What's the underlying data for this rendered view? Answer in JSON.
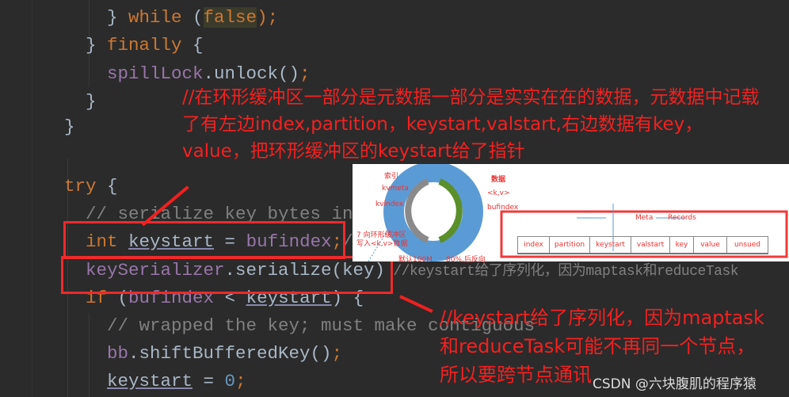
{
  "code_lines": [
    {
      "parts": [
        [
          "",
          "} "
        ],
        [
          "kw",
          "while"
        ],
        [
          "",
          " ("
        ],
        [
          "hl",
          "false"
        ],
        [
          "kw",
          ")"
        ],
        [
          "kw",
          ";"
        ]
      ]
    },
    {
      "parts": [
        [
          "",
          "} "
        ],
        [
          "kw",
          "finally"
        ],
        [
          "",
          " {"
        ]
      ]
    },
    {
      "parts": [
        [
          "id",
          "spillLock"
        ],
        [
          "",
          ".unlock()"
        ],
        [
          "kw",
          ";"
        ]
      ]
    },
    {
      "parts": [
        [
          "",
          "}"
        ]
      ]
    },
    {
      "parts": [
        [
          "",
          "}"
        ]
      ]
    },
    {
      "parts": []
    },
    {
      "parts": [
        [
          "kw",
          "try"
        ],
        [
          "",
          " {"
        ]
      ]
    },
    {
      "parts": [
        [
          "cm",
          "// serialize key bytes in"
        ]
      ]
    },
    {
      "parts": [
        [
          "kw",
          "int "
        ],
        [
          "u",
          "keystart"
        ],
        [
          "",
          " = "
        ],
        [
          "id",
          "bufindex"
        ],
        [
          "kw",
          ";"
        ],
        [
          "cm",
          "//"
        ]
      ]
    },
    {
      "parts": [
        [
          "id",
          "keySerializer"
        ],
        [
          "",
          ".serialize(key)"
        ],
        [
          "cm",
          " //keystart给了序列化，因为maptask和reduceTask"
        ]
      ]
    },
    {
      "parts": [
        [
          "kw",
          "if"
        ],
        [
          "",
          " ("
        ],
        [
          "id",
          "bufindex"
        ],
        [
          "",
          " < "
        ],
        [
          "u",
          "keystart"
        ],
        [
          "",
          ") {"
        ]
      ]
    },
    {
      "parts": [
        [
          "cm",
          "// wrapped the key; must make contiguous"
        ]
      ]
    },
    {
      "parts": [
        [
          "id",
          "bb"
        ],
        [
          "",
          ".shiftBufferedKey()"
        ],
        [
          "kw",
          ";"
        ]
      ]
    },
    {
      "parts": [
        [
          "u",
          "keystart"
        ],
        [
          "",
          " = "
        ],
        [
          "num",
          "0"
        ],
        [
          "kw",
          ";"
        ]
      ]
    }
  ],
  "annotations": {
    "top": "//在环形缓冲区一部分是元数据一部分是实实在在的数据，元数据中记载了有左边index,partition，keystart,valstart,右边数据有key，value，把环形缓冲区的keystart给了指针",
    "bottom": "//keystart给了序列化，因为maptask和reduceTask可能不再同一个节点，所以要跨节点通讯"
  },
  "inset": {
    "labels": {
      "index_cn": "索引",
      "kvmeta": "kvmeta",
      "kvindex": "kvindex",
      "write": "7 向环形缓冲区\n写入<k,v>数据",
      "default": "默认100M",
      "data_cn": "数据",
      "kv": "<k,v>",
      "bufindex": "bufindex",
      "spill": "80%,后反向",
      "meta": "Meta",
      "records": "Records"
    },
    "table": [
      "index",
      "partition",
      "keystart",
      "valstart",
      "key",
      "value",
      "unsued"
    ]
  },
  "watermark": "CSDN @六块腹肌的程序猿",
  "colors": {
    "annotation": "#f52020",
    "ring": "#5b9bd5",
    "arrow_green": "#5a8f2a",
    "arrow_gray": "#8a8a8a"
  }
}
